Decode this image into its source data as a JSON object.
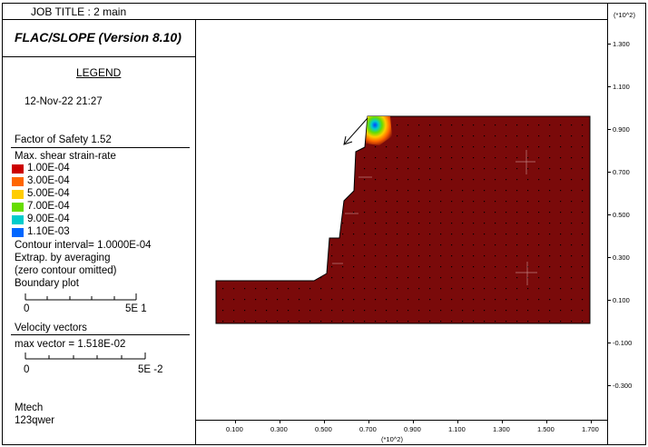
{
  "header": {
    "job_title": "JOB TITLE : 2 main",
    "scale_top_right": "(*10^2)"
  },
  "title": {
    "program": "FLAC/SLOPE (Version 8.10)"
  },
  "legend": {
    "heading": "LEGEND",
    "date": "12-Nov-22  21:27",
    "factor_of_safety": "Factor of Safety  1.52",
    "contour_title": "Max. shear strain-rate",
    "contours": [
      {
        "label": "1.00E-04",
        "color": "#cc0000"
      },
      {
        "label": "3.00E-04",
        "color": "#ff6600"
      },
      {
        "label": "5.00E-04",
        "color": "#ffcc00"
      },
      {
        "label": "7.00E-04",
        "color": "#66dd00"
      },
      {
        "label": "9.00E-04",
        "color": "#00cccc"
      },
      {
        "label": "1.10E-03",
        "color": "#0066ff"
      }
    ],
    "contour_interval": "Contour interval=  1.0000E-04",
    "extrap": "Extrap. by averaging",
    "zero_contour": "(zero contour omitted)",
    "boundary_plot": "Boundary plot",
    "boundary_scale_left": "0",
    "boundary_scale_right": "5E  1",
    "velocity_heading": "Velocity vectors",
    "max_vector": "max vector =     1.518E-02",
    "velocity_scale_left": "0",
    "velocity_scale_right": "5E -2",
    "author_line1": "Mtech",
    "author_line2": "123qwer"
  },
  "plot": {
    "model_color": "#7a0a0a",
    "y_ticks": [
      "1.300",
      "1.100",
      "0.900",
      "0.700",
      "0.500",
      "0.300",
      "0.100",
      "-0.100",
      "-0.300"
    ],
    "x_ticks": [
      "0.100",
      "0.300",
      "0.500",
      "0.700",
      "0.900",
      "1.100",
      "1.300",
      "1.500",
      "1.700"
    ],
    "x_scale_label": "(*10^2)"
  }
}
